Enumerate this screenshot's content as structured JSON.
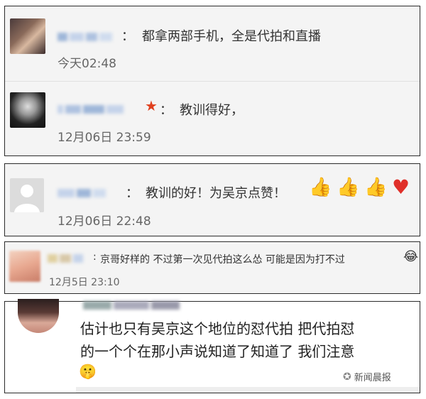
{
  "comments": [
    {
      "message": "都拿两部手机，全是代拍和直播",
      "time": "今天02:48"
    },
    {
      "message": "教训得好，",
      "time": "12月06日 23:59"
    },
    {
      "message": "教训的好！为吴京点赞！",
      "time": "12月06日 22:48"
    },
    {
      "message": "京哥好样的 不过第一次见代拍这么怂 可能是因为打不过",
      "time": "12月5日 23:10"
    },
    {
      "message_line1": "估计也只有吴京这个地位的怼代拍 把代拍怼",
      "message_line2": "的一个个在那小声说知道了知道了 我们注意"
    }
  ],
  "colon": "：",
  "watermark": "新闻晨报",
  "icons": [
    "star-icon",
    "thumbs-up-icon",
    "heart-icon",
    "laughing-emoji",
    "shushing-emoji",
    "wechat-icon"
  ]
}
